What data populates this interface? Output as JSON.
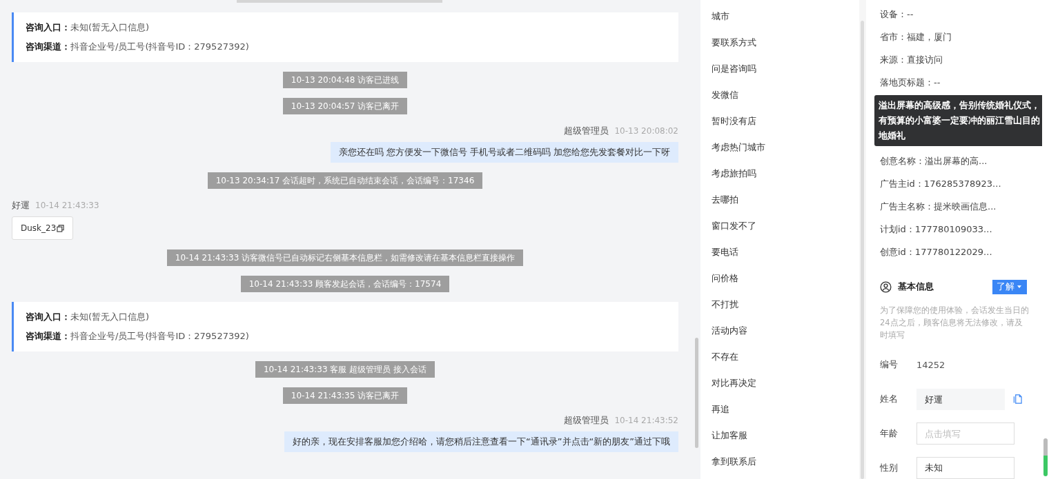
{
  "chat": {
    "messages": [
      {
        "kind": "info",
        "entry_label": "咨询入口：",
        "entry_value": "未知(暂无入口信息)",
        "channel_label": "咨询渠道：",
        "channel_value": "抖音企业号/员工号(抖音号ID：279527392)"
      },
      {
        "kind": "system",
        "text": "10-13 20:04:48 访客已进线"
      },
      {
        "kind": "system",
        "text": "10-13 20:04:57 访客已离开"
      },
      {
        "kind": "agent",
        "sender": "超级管理员",
        "time": "10-13 20:08:02",
        "text": "亲您还在吗 您方便发一下微信号 手机号或者二维码吗 加您给您先发套餐对比一下呀"
      },
      {
        "kind": "system",
        "text": "10-13 20:34:17 会话超时，系统已自动结束会话，会话编号：17346"
      },
      {
        "kind": "visitor",
        "sender": "好運",
        "time": "10-14 21:43:33",
        "text": "Dusk_23"
      },
      {
        "kind": "system",
        "text": "10-14 21:43:33 访客微信号已自动标记右侧基本信息栏，如需修改请在基本信息栏直接操作"
      },
      {
        "kind": "system",
        "text": "10-14 21:43:33 顾客发起会话，会话编号：17574"
      },
      {
        "kind": "info",
        "entry_label": "咨询入口：",
        "entry_value": "未知(暂无入口信息)",
        "channel_label": "咨询渠道：",
        "channel_value": "抖音企业号/员工号(抖音号ID：279527392)"
      },
      {
        "kind": "system",
        "text": "10-14 21:43:33 客服 超级管理员 接入会话"
      },
      {
        "kind": "system",
        "text": "10-14 21:43:35 访客已离开"
      },
      {
        "kind": "agent",
        "sender": "超级管理员",
        "time": "10-14 21:43:52",
        "text": "好的亲，现在安排客服加您介绍哈，请您稍后注意查看一下“通讯录”并点击“新的朋友”通过下哦"
      }
    ]
  },
  "quick_replies": [
    "城市",
    "要联系方式",
    "问是咨询吗",
    "发微信",
    "暂时没有店",
    "考虑热门城市",
    "考虑旅拍吗",
    "去哪拍",
    "窗口发不了",
    "要电话",
    "问价格",
    "不打扰",
    "活动内容",
    "不存在",
    "对比再决定",
    "再追",
    "让加客服",
    "拿到联系后"
  ],
  "visitor_info": {
    "rows_top": [
      "设备：--",
      "省市：福建，厦门",
      "来源：直接访问",
      "落地页标题：--"
    ],
    "tooltip": "溢出屏幕的高级感，告别传统婚礼仪式，有预算的小富婆一定要冲的丽江雪山目的地婚礼",
    "rows_bottom": [
      "创意名称：溢出屏幕的高...",
      "广告主id：176285378923...",
      "广告主名称：提米映画信息...",
      "计划id：177780109033...",
      "创意id：177780122029..."
    ]
  },
  "basic_info": {
    "title": "基本信息",
    "button": "了解",
    "note": "为了保障您的使用体验，会话发生当日的24点之后，顾客信息将无法修改，请及时填写",
    "fields": [
      {
        "kind": "text",
        "label": "编号",
        "value": "14252"
      },
      {
        "kind": "filled",
        "label": "姓名",
        "value": "好運"
      },
      {
        "kind": "input",
        "label": "年龄",
        "placeholder": "点击填写"
      },
      {
        "kind": "input",
        "label": "性别",
        "value": "未知"
      }
    ]
  }
}
